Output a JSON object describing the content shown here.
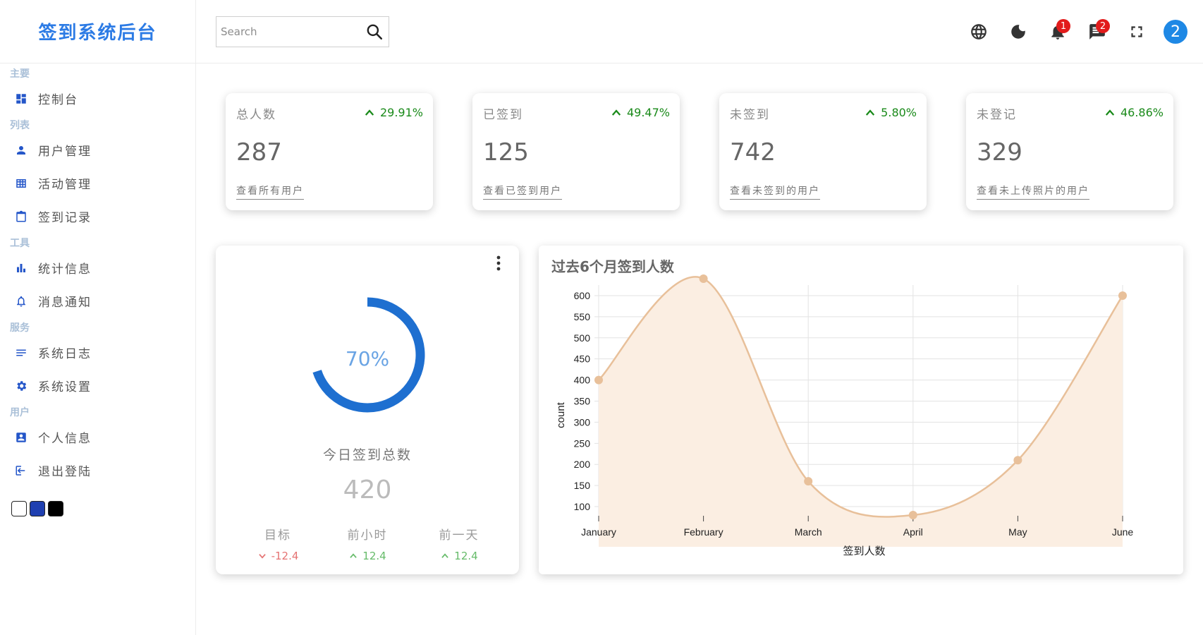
{
  "app": {
    "title": "签到系统后台"
  },
  "sidebar": {
    "sections": [
      {
        "label": "主要",
        "items": [
          {
            "label": "控制台",
            "icon": "dashboard-icon"
          }
        ]
      },
      {
        "label": "列表",
        "items": [
          {
            "label": "用户管理",
            "icon": "person-icon"
          },
          {
            "label": "活动管理",
            "icon": "table-icon"
          },
          {
            "label": "签到记录",
            "icon": "clipboard-icon"
          }
        ]
      },
      {
        "label": "工具",
        "items": [
          {
            "label": "统计信息",
            "icon": "bar-chart-icon"
          },
          {
            "label": "消息通知",
            "icon": "bell-icon"
          }
        ]
      },
      {
        "label": "服务",
        "items": [
          {
            "label": "系统日志",
            "icon": "list-icon"
          },
          {
            "label": "系统设置",
            "icon": "gear-icon"
          }
        ]
      },
      {
        "label": "用户",
        "items": [
          {
            "label": "个人信息",
            "icon": "profile-icon"
          },
          {
            "label": "退出登陆",
            "icon": "logout-icon"
          }
        ]
      }
    ],
    "theme_swatches": [
      "#ffffff",
      "#1f3fb0",
      "#000000"
    ]
  },
  "topbar": {
    "search_placeholder": "Search",
    "notifications_count": "1",
    "messages_count": "2",
    "avatar_text": "2"
  },
  "stats": [
    {
      "title": "总人数",
      "change": "29.91%",
      "value": "287",
      "link": "查看所有用户"
    },
    {
      "title": "已签到",
      "change": "49.47%",
      "value": "125",
      "link": "查看已签到用户"
    },
    {
      "title": "未签到",
      "change": "5.80%",
      "value": "742",
      "link": "查看未签到的用户"
    },
    {
      "title": "未登记",
      "change": "46.86%",
      "value": "329",
      "link": "查看未上传照片的用户"
    }
  ],
  "today": {
    "progress_percent": 70,
    "progress_label": "70%",
    "caption": "今日签到总数",
    "total": "420",
    "metrics": [
      {
        "label": "目标",
        "value": "-12.4",
        "trend": "down",
        "color": "#e57373"
      },
      {
        "label": "前小时",
        "value": "12.4",
        "trend": "up",
        "color": "#66bb6a"
      },
      {
        "label": "前一天",
        "value": "12.4",
        "trend": "up",
        "color": "#66bb6a"
      }
    ]
  },
  "chart_data": {
    "type": "area",
    "title": "过去6个月签到人数",
    "xlabel": "签到人数",
    "ylabel": "count",
    "categories": [
      "January",
      "February",
      "March",
      "April",
      "May",
      "June"
    ],
    "series": [
      {
        "values": [
          400,
          640,
          160,
          80,
          210,
          600
        ]
      }
    ],
    "ylim": [
      75,
      625
    ],
    "yticks": [
      100,
      150,
      200,
      250,
      300,
      350,
      400,
      450,
      500,
      550,
      600
    ],
    "grid": true,
    "color": "#e8c09a"
  }
}
